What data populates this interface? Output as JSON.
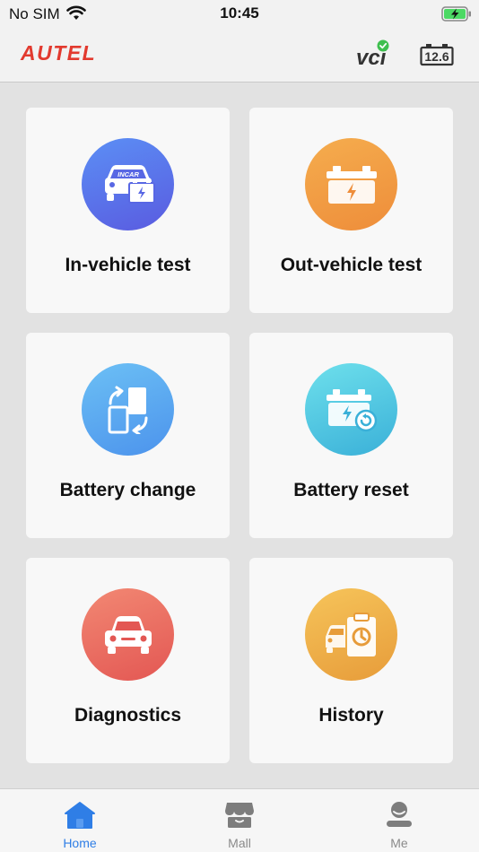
{
  "status_bar": {
    "carrier": "No SIM",
    "time": "10:45",
    "wifi_icon": "wifi-icon",
    "battery_icon": "battery-charging-icon"
  },
  "header": {
    "logo": "AUTEL",
    "vci_label": "VCI",
    "vci_status": "connected",
    "battery_voltage": "12.6"
  },
  "tiles": [
    {
      "label": "In-vehicle test",
      "icon": "car-battery-icon",
      "icon_text": "INCAR",
      "color": "#5a74ea"
    },
    {
      "label": "Out-vehicle test",
      "icon": "battery-icon",
      "color": "#f19e44"
    },
    {
      "label": "Battery change",
      "icon": "battery-swap-icon",
      "color": "#5aa8f0"
    },
    {
      "label": "Battery reset",
      "icon": "battery-reset-icon",
      "color": "#4cc5e2"
    },
    {
      "label": "Diagnostics",
      "icon": "car-icon",
      "color": "#ea6c63"
    },
    {
      "label": "History",
      "icon": "history-clipboard-icon",
      "color": "#efb04a"
    }
  ],
  "tab_bar": {
    "items": [
      {
        "label": "Home",
        "icon": "home-icon",
        "active": true
      },
      {
        "label": "Mall",
        "icon": "store-icon",
        "active": false
      },
      {
        "label": "Me",
        "icon": "user-icon",
        "active": false
      }
    ],
    "active_color": "#2f7ee6",
    "inactive_color": "#8a8a8a"
  }
}
